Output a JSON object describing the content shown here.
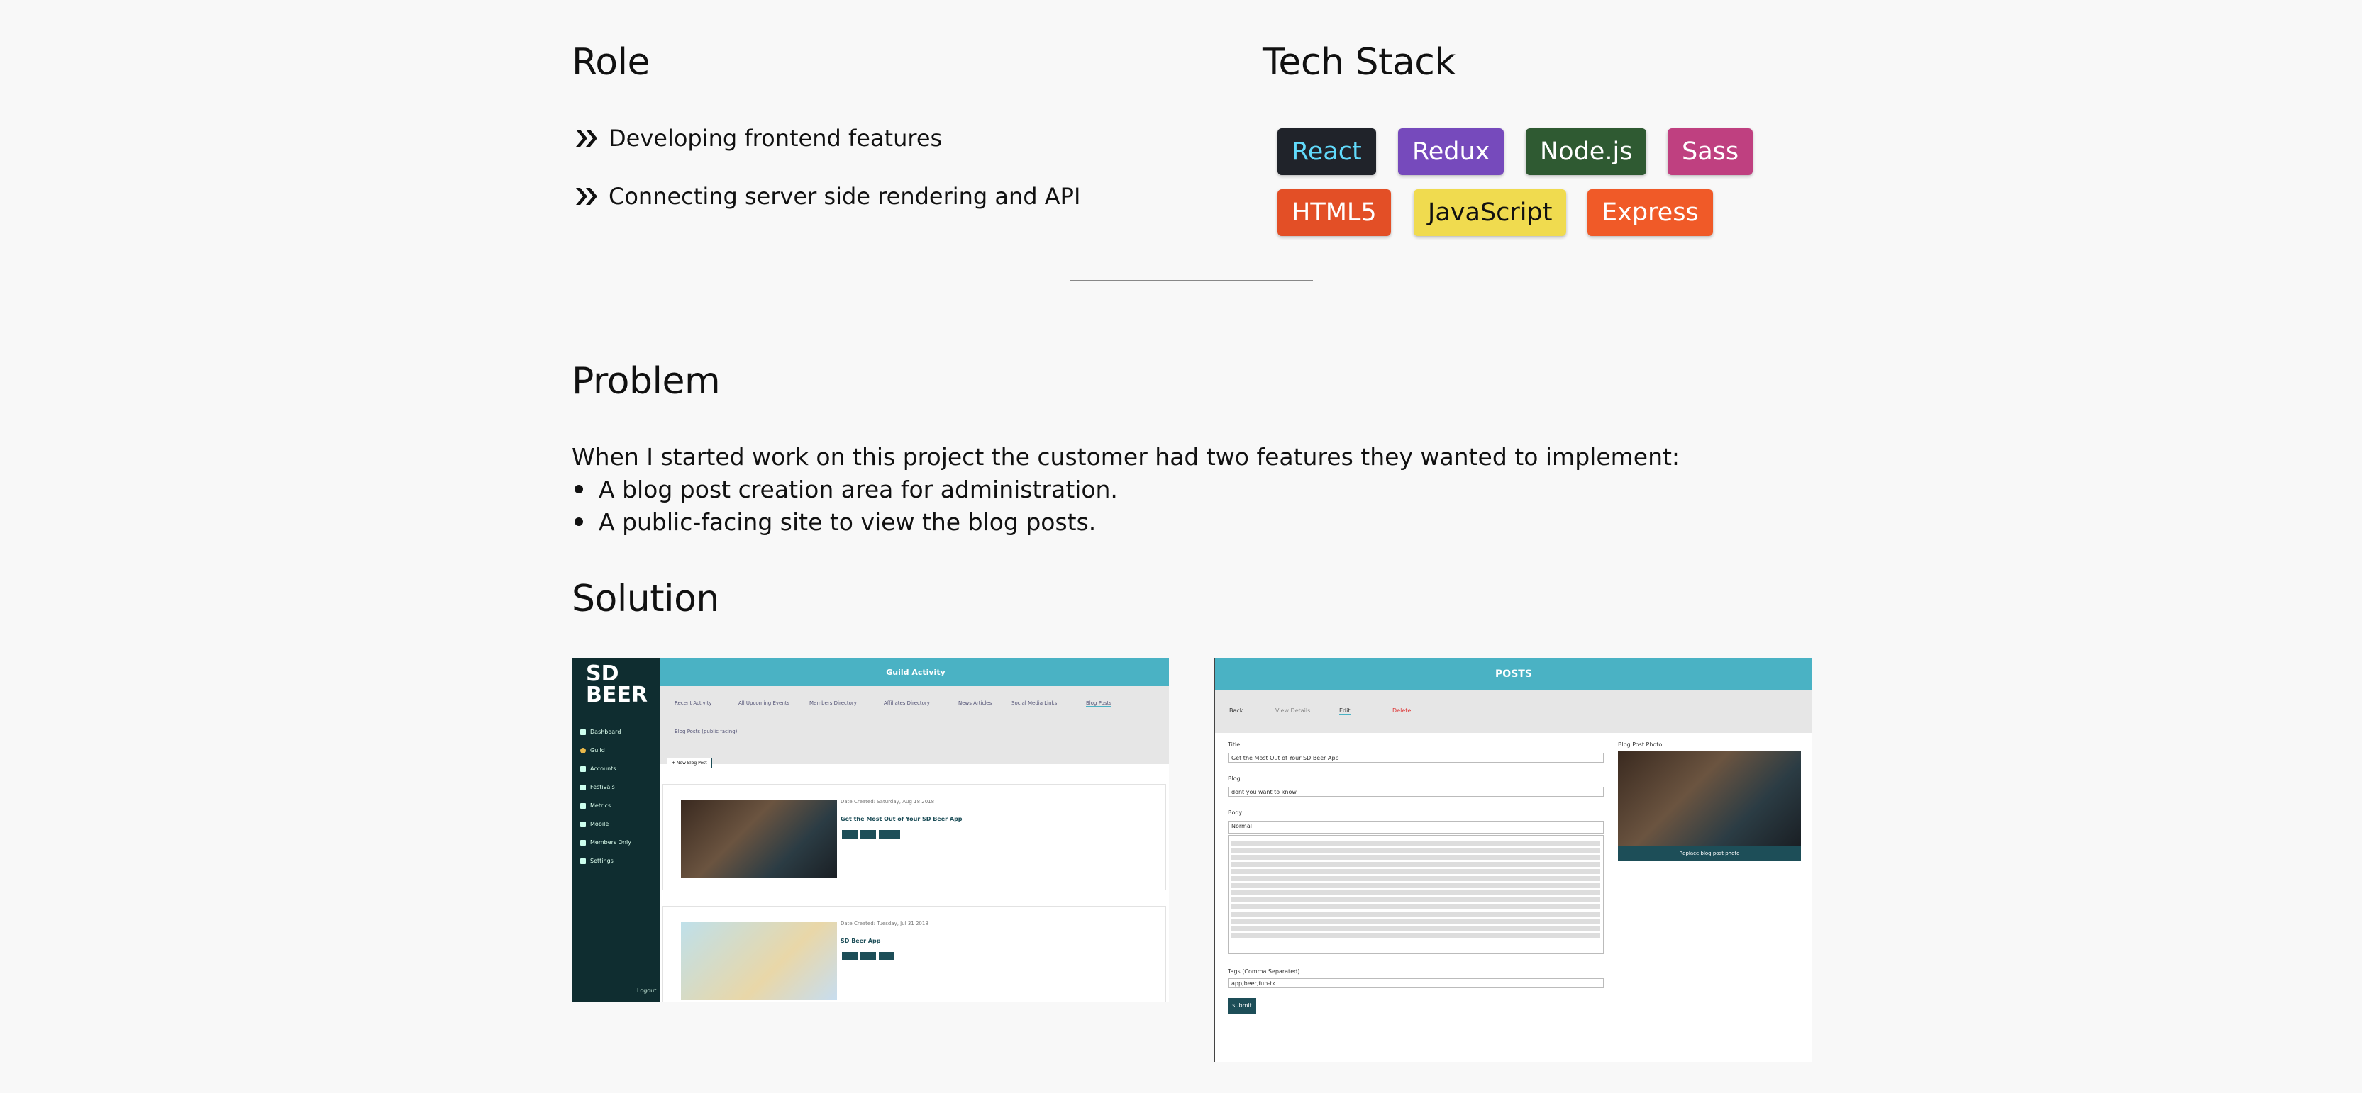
{
  "role": {
    "heading": "Role",
    "items": [
      "Developing frontend features",
      "Connecting server side rendering and API"
    ]
  },
  "tech": {
    "heading": "Tech Stack",
    "badges": [
      {
        "label": "React",
        "bg": "#20232a",
        "fg": "#61dafb"
      },
      {
        "label": "Redux",
        "bg": "#764abc",
        "fg": "#ffffff"
      },
      {
        "label": "Node.js",
        "bg": "#2f5a32",
        "fg": "#ffffff"
      },
      {
        "label": "Sass",
        "bg": "#bf4080",
        "fg": "#ffffff"
      },
      {
        "label": "HTML5",
        "bg": "#e34f26",
        "fg": "#ffffff"
      },
      {
        "label": "JavaScript",
        "bg": "#f0db4f",
        "fg": "#111111"
      },
      {
        "label": "Express",
        "bg": "#f05a28",
        "fg": "#ffffff"
      }
    ]
  },
  "problem": {
    "heading": "Problem",
    "intro": "When I started work on this project the customer had two features they wanted to implement:",
    "bullets": [
      "A blog post creation area for administration.",
      "A public-facing site to view the blog posts."
    ]
  },
  "solution": {
    "heading": "Solution",
    "shot1": {
      "logo_line1": "SD",
      "logo_line2": "BEER",
      "header": "Guild Activity",
      "nav": [
        "Dashboard",
        "Guild",
        "Accounts",
        "Festivals",
        "Metrics",
        "Mobile",
        "Members Only",
        "Settings"
      ],
      "logout": "Logout",
      "tabs": [
        "Recent Activity",
        "All Upcoming Events",
        "Members Directory",
        "Affiliates Directory",
        "News Articles",
        "Social Media Links",
        "Blog Posts"
      ],
      "tab_sub": "Blog Posts (public facing)",
      "new_button": "+ New Blog Post",
      "posts": [
        {
          "date": "Date Created: Saturday, Aug 18 2018",
          "title": "Get the Most Out of Your SD Beer App"
        },
        {
          "date": "Date Created: Tuesday, Jul 31 2018",
          "title": "SD Beer App"
        }
      ]
    },
    "shot2": {
      "header": "POSTS",
      "toolbar": [
        "Back",
        "View Details",
        "Edit",
        "Delete"
      ],
      "title_label": "Title",
      "title_value": "Get the Most Out of Your SD Beer App",
      "blog_label": "Blog",
      "blog_value": "dont you want to know",
      "body_label": "Body",
      "editor_mode": "Normal",
      "tags_label": "Tags (Comma Separated)",
      "tags_value": "app,beer,fun-tk",
      "submit_label": "submit",
      "photo_label": "Blog Post Photo",
      "photo_caption": "Replace blog post photo"
    }
  }
}
